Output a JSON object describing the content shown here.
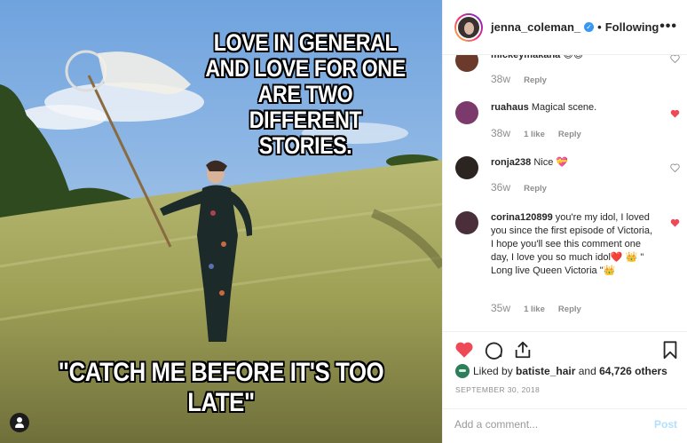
{
  "post": {
    "meme_top": "LOVE IN GENERAL AND LOVE FOR ONE ARE TWO DIFFERENT STORIES.",
    "meme_bottom": "\"CATCH ME BEFORE IT'S TOO LATE\""
  },
  "header": {
    "username": "jenna_coleman_",
    "verified_icon": "verified-check-icon",
    "separator": "•",
    "follow_label": "Following",
    "more_label": "•••"
  },
  "comments": [
    {
      "user": "mickeymakana",
      "text": "😊😊",
      "age": "38w",
      "likes": "",
      "reply": "Reply",
      "liked": false,
      "avatar_color": "#6b3a2a"
    },
    {
      "user": "ruahaus",
      "text": "Magical scene.",
      "age": "38w",
      "likes": "1 like",
      "reply": "Reply",
      "liked": true,
      "avatar_color": "#7b3a6b"
    },
    {
      "user": "ronja238",
      "text": "Nice 💝",
      "age": "36w",
      "likes": "",
      "reply": "Reply",
      "liked": false,
      "avatar_color": "#2b2420"
    },
    {
      "user": "corina120899",
      "text": "you're my idol, I loved you since the first episode of Victoria, I hope you'll see this comment one day, I love you so much idol❤️ 👑 \" Long live Queen Victoria \"👑",
      "age": "35w",
      "likes": "1 like",
      "reply": "Reply",
      "liked": true,
      "avatar_color": "#4a2f3a"
    }
  ],
  "actions": {
    "like_icon": "heart-filled-icon",
    "comment_icon": "comment-icon",
    "share_icon": "share-icon",
    "save_icon": "bookmark-icon",
    "like_color": "#ed4956"
  },
  "likes": {
    "prefix": "Liked by",
    "user": "batiste_hair",
    "conj": "and",
    "count": "64,726 others"
  },
  "date": "SEPTEMBER 30, 2018",
  "add_comment": {
    "placeholder": "Add a comment...",
    "post_label": "Post"
  }
}
